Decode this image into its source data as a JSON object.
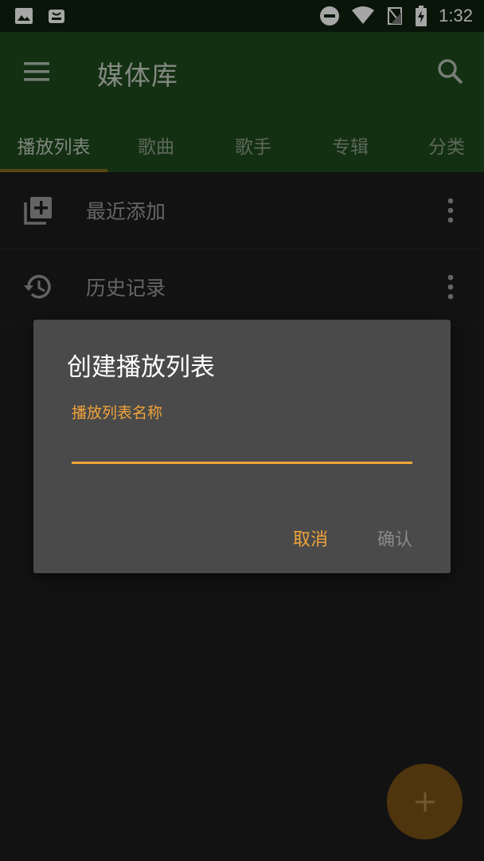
{
  "status_bar": {
    "time": "1:32",
    "icons": [
      "image-icon",
      "app-notification-icon",
      "do-not-disturb-icon",
      "wifi-icon",
      "no-signal-icon",
      "battery-charging-icon"
    ]
  },
  "app_bar": {
    "title": "媒体库",
    "tabs": [
      {
        "label": "播放列表",
        "active": true
      },
      {
        "label": "歌曲",
        "active": false
      },
      {
        "label": "歌手",
        "active": false
      },
      {
        "label": "专辑",
        "active": false
      },
      {
        "label": "分类",
        "active": false
      }
    ]
  },
  "list": {
    "items": [
      {
        "label": "最近添加",
        "icon": "add-to-queue-icon"
      },
      {
        "label": "历史记录",
        "icon": "history-icon"
      }
    ]
  },
  "dialog": {
    "title": "创建播放列表",
    "field_label": "播放列表名称",
    "field_value": "",
    "cancel_label": "取消",
    "confirm_label": "确认"
  },
  "fab": {
    "icon": "plus-icon"
  },
  "colors": {
    "accent": "#f0a33a",
    "app_bar": "#1e4a1d",
    "status_bar": "#0f210f",
    "background": "#1c1c1c",
    "dialog": "#4a4a4a"
  }
}
